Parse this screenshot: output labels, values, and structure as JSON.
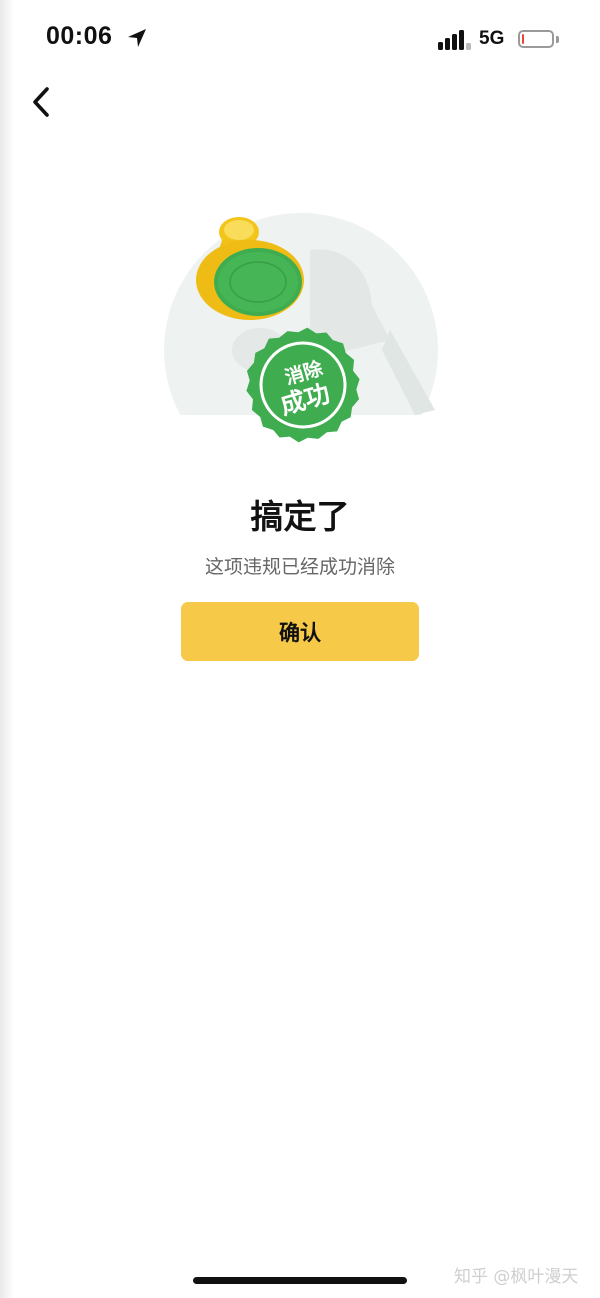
{
  "status_bar": {
    "time": "00:06",
    "network": "5G",
    "location_icon": "location-arrow-icon",
    "signal_icon": "signal-bars-icon",
    "battery_icon": "battery-low-icon",
    "battery_level": 0.08
  },
  "nav": {
    "back_icon": "chevron-left-icon"
  },
  "illustration": {
    "stamp_text": "消除成功",
    "stamp_line1": "消除",
    "stamp_line2": "成功",
    "colors": {
      "stamp_green": "#3fad4f",
      "handle_yellow": "#f5c927",
      "backdrop": "#eef2f1"
    }
  },
  "result": {
    "title": "搞定了",
    "subtitle": "这项违规已经成功消除",
    "confirm_label": "确认"
  },
  "watermark": "知乎 @枫叶漫天",
  "colors": {
    "accent": "#f6c948",
    "battery_low": "#e8463b"
  }
}
